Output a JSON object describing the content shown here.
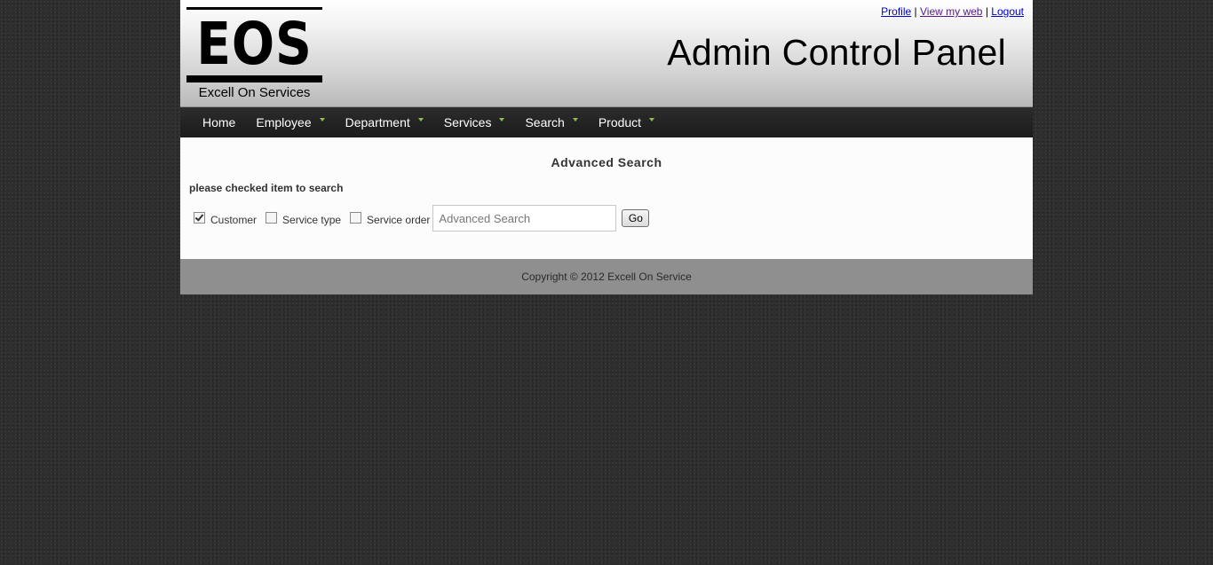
{
  "header": {
    "logo": {
      "text": "EOS",
      "subtitle": "Excell On Services"
    },
    "title": "Admin Control Panel",
    "links": [
      {
        "label": "Profile"
      },
      {
        "label": "View my web"
      },
      {
        "label": "Logout"
      }
    ],
    "separator": "|"
  },
  "nav": {
    "items": [
      {
        "label": "Home",
        "has_dropdown": false
      },
      {
        "label": "Employee",
        "has_dropdown": true
      },
      {
        "label": "Department",
        "has_dropdown": true
      },
      {
        "label": "Services",
        "has_dropdown": true
      },
      {
        "label": "Search",
        "has_dropdown": true
      },
      {
        "label": "Product",
        "has_dropdown": true
      }
    ],
    "caret_color": "#8bc34a"
  },
  "content": {
    "title": "Advanced Search",
    "instructions": "please checked item to search",
    "options": [
      {
        "label": "Customer",
        "checked": true
      },
      {
        "label": "Service type",
        "checked": false
      },
      {
        "label": "Service order",
        "checked": false
      }
    ],
    "search": {
      "placeholder": "Advanced Search",
      "value": ""
    },
    "go_label": "Go"
  },
  "footer": {
    "copyright": "Copyright © 2012 Excell On Service"
  }
}
